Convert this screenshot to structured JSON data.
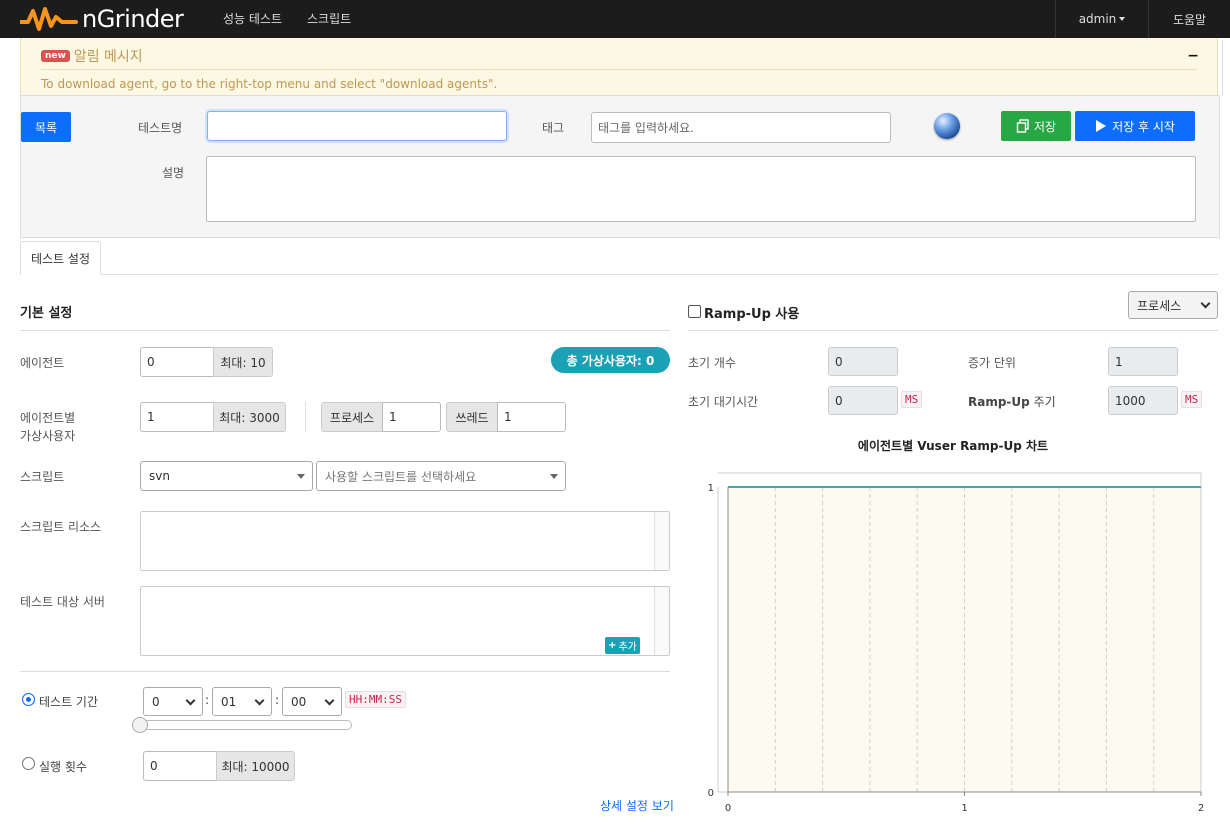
{
  "nav": {
    "brand": "nGrinder",
    "menu": [
      "성능 테스트",
      "스크립트"
    ],
    "user": "admin",
    "help": "도움말"
  },
  "alert": {
    "badge": "new",
    "title": "알림 메시지",
    "message": "To download agent, go to the right-top menu and select \"download agents\".",
    "minimize": "−"
  },
  "form": {
    "list_button": "목록",
    "test_name_label": "테스트명",
    "test_name_value": "",
    "tag_label": "태그",
    "tag_placeholder": "태그를 입력하세요.",
    "save_button": "저장",
    "save_run_button": "저장 후 시작",
    "description_label": "설명"
  },
  "tabs": [
    "테스트 설정"
  ],
  "basic": {
    "title": "기본 설정",
    "agent_label": "에이전트",
    "agent_value": "0",
    "agent_max": "최대: 10",
    "total_vusers": "총 가상사용자: 0",
    "vuser_label_1": "에이전트별",
    "vuser_label_2": "가상사용자",
    "vuser_value": "1",
    "vuser_max": "최대: 3000",
    "process_label": "프로세스",
    "process_value": "1",
    "thread_label": "쓰레드",
    "thread_value": "1",
    "script_label": "스크립트",
    "script_repo": "svn",
    "script_placeholder": "사용할 스크립트를 선택하세요",
    "resource_label": "스크립트 리소스",
    "target_label": "테스트 대상 서버",
    "add_button": "추가",
    "duration_label": "테스트 기간",
    "hours": "0",
    "minutes": "01",
    "seconds": "00",
    "time_format": "HH:MM:SS",
    "runcount_label": "실행 횟수",
    "runcount_value": "0",
    "runcount_max": "최대: 10000",
    "advanced_link": "상세 설정 보기",
    "duration_selected": true,
    "duration_slider_fraction": 0
  },
  "rampup": {
    "title": "Ramp-Up 사용",
    "enabled": false,
    "type_select": "프로세스",
    "initial_count_label": "초기 개수",
    "initial_count": "0",
    "increment_label": "증가 단위",
    "increment": "1",
    "initial_sleep_label": "초기 대기시간",
    "initial_sleep": "0",
    "ms_unit": "MS",
    "interval_label_bold": "Ramp-Up",
    "interval_label_rest": " 주기",
    "interval": "1000",
    "interval_unit": "MS"
  },
  "chart_data": {
    "type": "line",
    "title": "에이전트별 Vuser Ramp-Up 차트",
    "x": [
      0,
      2
    ],
    "series": [
      {
        "values": [
          1,
          1
        ]
      }
    ],
    "xlim": [
      0,
      2
    ],
    "ylim": [
      0,
      1
    ],
    "xticks": [
      "0",
      "1",
      "2"
    ],
    "yticks": [
      "0",
      "1"
    ],
    "grid": "vertical dashed",
    "colors": {
      "line": "#4aa3b5",
      "plot_bg": "#fdfaef"
    }
  }
}
